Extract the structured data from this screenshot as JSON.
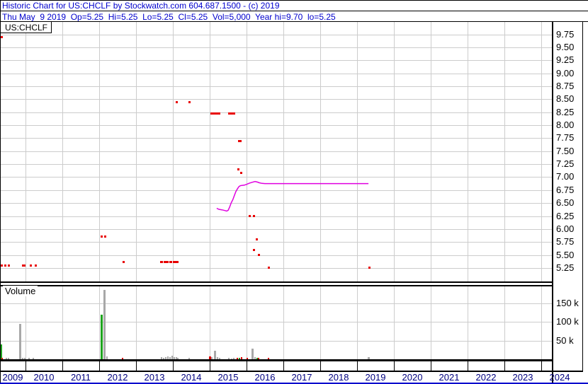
{
  "header": {
    "line1": "Historic Chart for US:CHCLF by Stockwatch.com 604.687.1500 - (c) 2019",
    "line2": "Thu May  9 2019  Op=5.25  Hi=5.25  Lo=5.25  Cl=5.25  Vol=5,000  Year hi=9.70  lo=5.25"
  },
  "price_panel": {
    "symbol_label": "US:CHCLF"
  },
  "volume_panel": {
    "label": "Volume"
  },
  "colors": {
    "header_text": "#0000cd",
    "year_text": "#000080",
    "axis_text": "#000000",
    "grid": "#cccccc",
    "trade_mark": "#e80000",
    "ma_line": "#e000e0",
    "volume_neutral": "#a8a8a8",
    "volume_up": "#1fa51f",
    "volume_down": "#dd0000",
    "frame": "#000000",
    "bottom_edge": "#0000cd"
  },
  "chart_data": {
    "type": "scatter",
    "title": "Historic trades for US:CHCLF with volume, axis 2009-2024, data through May 9 2019",
    "price_axis": {
      "tick_labels": [
        "9.75",
        "9.50",
        "9.25",
        "9.00",
        "8.75",
        "8.50",
        "8.25",
        "8.00",
        "7.75",
        "7.50",
        "7.25",
        "7.00",
        "6.75",
        "6.50",
        "6.25",
        "6.00",
        "5.75",
        "5.50",
        "5.25"
      ],
      "max": 9.75,
      "min": 5.25,
      "step": 0.25,
      "grid": true,
      "position": "right"
    },
    "x_axis": {
      "year_labels": [
        "2009",
        "2010",
        "2011",
        "2012",
        "2013",
        "2014",
        "2015",
        "2016",
        "2017",
        "2018",
        "2019",
        "2020",
        "2021",
        "2022",
        "2023",
        "2024"
      ],
      "grid": true
    },
    "volume_axis": {
      "tick_labels": [
        "150 k",
        "100 k",
        "50 k"
      ],
      "tick_values_k": [
        150,
        100,
        50
      ],
      "grid": true,
      "position": "right"
    },
    "last_trade": {
      "date": "Thu May 9 2019",
      "open": 5.25,
      "high": 5.25,
      "low": 5.25,
      "close": 5.25,
      "volume": 5000,
      "year_high": 9.7,
      "year_low": 5.25
    },
    "trades": [
      {
        "year": 2009.31,
        "price": 9.7,
        "w": 4
      },
      {
        "year": 2009.31,
        "price": 5.3,
        "w": 4
      },
      {
        "year": 2009.46,
        "price": 5.3,
        "w": 3
      },
      {
        "year": 2009.54,
        "price": 5.3,
        "w": 3
      },
      {
        "year": 2009.96,
        "price": 5.3,
        "w": 5
      },
      {
        "year": 2010.15,
        "price": 5.3,
        "w": 3
      },
      {
        "year": 2010.27,
        "price": 5.3,
        "w": 3
      },
      {
        "year": 2012.07,
        "price": 5.85,
        "w": 3
      },
      {
        "year": 2012.16,
        "price": 5.85,
        "w": 3
      },
      {
        "year": 2012.66,
        "price": 5.37,
        "w": 3
      },
      {
        "year": 2013.7,
        "price": 5.36,
        "w": 4
      },
      {
        "year": 2013.79,
        "price": 5.36,
        "w": 4
      },
      {
        "year": 2013.86,
        "price": 5.36,
        "w": 3
      },
      {
        "year": 2013.95,
        "price": 5.36,
        "w": 4
      },
      {
        "year": 2014.04,
        "price": 5.36,
        "w": 4
      },
      {
        "year": 2014.12,
        "price": 5.36,
        "w": 4
      },
      {
        "year": 2014.11,
        "price": 8.45,
        "w": 3
      },
      {
        "year": 2014.46,
        "price": 8.45,
        "w": 3
      },
      {
        "year": 2015.08,
        "price": 8.22,
        "w": 7
      },
      {
        "year": 2015.23,
        "price": 8.22,
        "w": 7
      },
      {
        "year": 2015.52,
        "price": 8.22,
        "w": 3
      },
      {
        "year": 2015.63,
        "price": 8.22,
        "w": 7
      },
      {
        "year": 2015.81,
        "price": 7.7,
        "w": 5
      },
      {
        "year": 2015.77,
        "price": 7.15,
        "w": 3
      },
      {
        "year": 2015.85,
        "price": 7.08,
        "w": 3
      },
      {
        "year": 2016.08,
        "price": 6.25,
        "w": 3
      },
      {
        "year": 2016.21,
        "price": 6.25,
        "w": 3
      },
      {
        "year": 2016.27,
        "price": 5.8,
        "w": 3
      },
      {
        "year": 2016.21,
        "price": 5.6,
        "w": 3
      },
      {
        "year": 2016.33,
        "price": 5.5,
        "w": 3
      },
      {
        "year": 2016.6,
        "price": 5.25,
        "w": 3
      },
      {
        "year": 2019.33,
        "price": 5.25,
        "w": 3
      }
    ],
    "ma_line_points": [
      [
        2015.19,
        6.4
      ],
      [
        2015.25,
        6.38
      ],
      [
        2015.33,
        6.37
      ],
      [
        2015.42,
        6.355
      ],
      [
        2015.46,
        6.345
      ],
      [
        2015.5,
        6.36
      ],
      [
        2015.54,
        6.42
      ],
      [
        2015.58,
        6.5
      ],
      [
        2015.63,
        6.57
      ],
      [
        2015.67,
        6.645
      ],
      [
        2015.71,
        6.72
      ],
      [
        2015.75,
        6.77
      ],
      [
        2015.79,
        6.815
      ],
      [
        2015.83,
        6.835
      ],
      [
        2015.87,
        6.84
      ],
      [
        2015.94,
        6.845
      ],
      [
        2016.0,
        6.86
      ],
      [
        2016.08,
        6.885
      ],
      [
        2016.15,
        6.9
      ],
      [
        2016.23,
        6.915
      ],
      [
        2016.29,
        6.905
      ],
      [
        2016.35,
        6.89
      ],
      [
        2016.42,
        6.88
      ],
      [
        2016.5,
        6.875
      ],
      [
        2019.31,
        6.875
      ]
    ],
    "volume_bars": [
      {
        "year": 2009.33,
        "k": 40,
        "dir": "up",
        "w": 3
      },
      {
        "year": 2009.37,
        "k": 3,
        "dir": "down",
        "w": 2
      },
      {
        "year": 2009.48,
        "k": 4,
        "dir": "neutral",
        "w": 2
      },
      {
        "year": 2009.54,
        "k": 3,
        "dir": "neutral",
        "w": 2
      },
      {
        "year": 2009.85,
        "k": 95,
        "dir": "neutral",
        "w": 3
      },
      {
        "year": 2009.92,
        "k": 4,
        "dir": "neutral",
        "w": 2
      },
      {
        "year": 2009.98,
        "k": 3,
        "dir": "neutral",
        "w": 2
      },
      {
        "year": 2010.1,
        "k": 4,
        "dir": "neutral",
        "w": 2
      },
      {
        "year": 2010.21,
        "k": 3,
        "dir": "neutral",
        "w": 2
      },
      {
        "year": 2012.06,
        "k": 118,
        "dir": "up",
        "w": 3
      },
      {
        "year": 2012.15,
        "k": 185,
        "dir": "neutral",
        "w": 3
      },
      {
        "year": 2012.21,
        "k": 8,
        "dir": "neutral",
        "w": 2
      },
      {
        "year": 2012.63,
        "k": 3,
        "dir": "down",
        "w": 2
      },
      {
        "year": 2013.69,
        "k": 5,
        "dir": "neutral",
        "w": 2
      },
      {
        "year": 2013.75,
        "k": 4,
        "dir": "neutral",
        "w": 2
      },
      {
        "year": 2013.81,
        "k": 6,
        "dir": "neutral",
        "w": 2
      },
      {
        "year": 2013.87,
        "k": 8,
        "dir": "neutral",
        "w": 2
      },
      {
        "year": 2013.92,
        "k": 5,
        "dir": "neutral",
        "w": 2
      },
      {
        "year": 2013.98,
        "k": 9,
        "dir": "neutral",
        "w": 2
      },
      {
        "year": 2014.04,
        "k": 6,
        "dir": "neutral",
        "w": 2
      },
      {
        "year": 2014.1,
        "k": 5,
        "dir": "neutral",
        "w": 2
      },
      {
        "year": 2014.13,
        "k": 3,
        "dir": "neutral",
        "w": 2
      },
      {
        "year": 2014.44,
        "k": 3,
        "dir": "neutral",
        "w": 2
      },
      {
        "year": 2015.0,
        "k": 8,
        "dir": "down",
        "w": 3
      },
      {
        "year": 2015.05,
        "k": 6,
        "dir": "neutral",
        "w": 2
      },
      {
        "year": 2015.15,
        "k": 23,
        "dir": "neutral",
        "w": 3
      },
      {
        "year": 2015.22,
        "k": 6,
        "dir": "neutral",
        "w": 2
      },
      {
        "year": 2015.27,
        "k": 4,
        "dir": "neutral",
        "w": 2
      },
      {
        "year": 2015.52,
        "k": 3,
        "dir": "neutral",
        "w": 2
      },
      {
        "year": 2015.6,
        "k": 2,
        "dir": "neutral",
        "w": 2
      },
      {
        "year": 2015.65,
        "k": 3,
        "dir": "neutral",
        "w": 2
      },
      {
        "year": 2015.75,
        "k": 4,
        "dir": "down",
        "w": 2
      },
      {
        "year": 2015.81,
        "k": 3,
        "dir": "up",
        "w": 2
      },
      {
        "year": 2015.87,
        "k": 5,
        "dir": "down",
        "w": 2
      },
      {
        "year": 2016.02,
        "k": 3,
        "dir": "down",
        "w": 2
      },
      {
        "year": 2016.17,
        "k": 28,
        "dir": "neutral",
        "w": 3
      },
      {
        "year": 2016.23,
        "k": 6,
        "dir": "neutral",
        "w": 2
      },
      {
        "year": 2016.28,
        "k": 3,
        "dir": "up",
        "w": 2
      },
      {
        "year": 2016.33,
        "k": 3,
        "dir": "down",
        "w": 2
      },
      {
        "year": 2016.6,
        "k": 3,
        "dir": "down",
        "w": 2
      },
      {
        "year": 2019.32,
        "k": 5,
        "dir": "neutral",
        "w": 3
      }
    ]
  }
}
